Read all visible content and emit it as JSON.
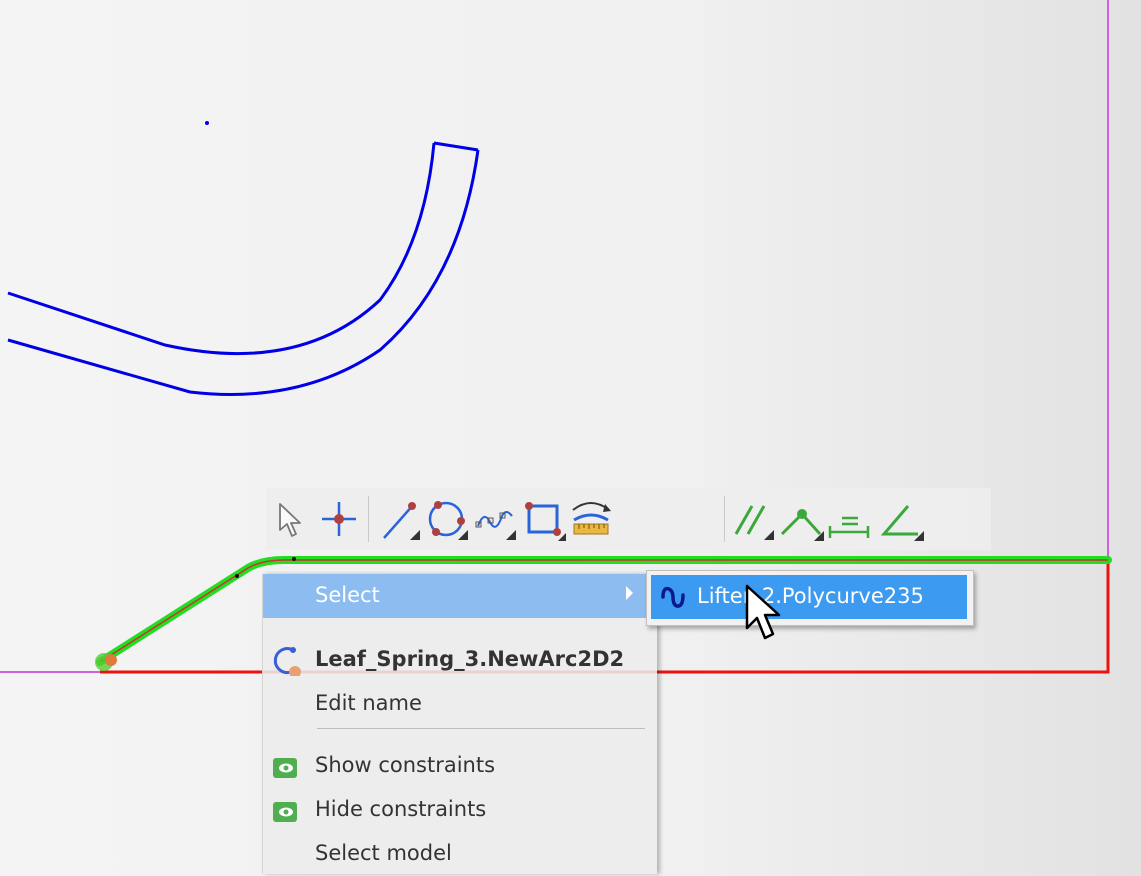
{
  "colors": {
    "sketch_blue": "#0000e6",
    "selection_green": "#22dd22",
    "profile_red": "#ee1111",
    "axis_magenta": "#d060e0",
    "menu_highlight": "#8dbdf0",
    "submenu_highlight": "#3c9af0"
  },
  "toolbar": {
    "tools": [
      {
        "icon": "select-arrow-icon"
      },
      {
        "icon": "point-icon"
      },
      {
        "icon": "line-icon"
      },
      {
        "icon": "circle-icon"
      },
      {
        "icon": "spline-icon"
      },
      {
        "icon": "rectangle-icon"
      },
      {
        "icon": "dimension-icon"
      },
      {
        "icon": "parallel-constraint-icon"
      },
      {
        "icon": "corner-icon"
      },
      {
        "icon": "equal-length-icon"
      },
      {
        "icon": "angle-icon"
      }
    ]
  },
  "context_menu": {
    "items": [
      {
        "label": "Select",
        "highlighted": true,
        "has_submenu": true
      },
      {
        "label": "Leaf_Spring_3.NewArc2D2",
        "icon": "arc-icon",
        "bold": true
      },
      {
        "label": "Edit name"
      },
      {
        "label": "Show constraints",
        "icon": "show-constraints-icon"
      },
      {
        "label": "Hide constraints",
        "icon": "hide-constraints-icon"
      },
      {
        "label": "Select model"
      }
    ]
  },
  "submenu": {
    "item": {
      "label": "Lifter_2.Polycurve235",
      "icon": "polycurve-icon"
    }
  }
}
